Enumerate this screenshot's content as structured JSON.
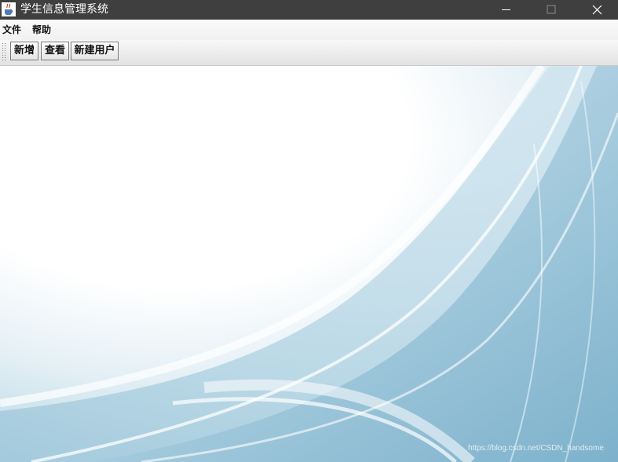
{
  "window": {
    "title": "学生信息管理系统",
    "app_icon": "java-cup-icon",
    "controls": [
      "minimize-icon",
      "maximize-icon",
      "close-icon"
    ]
  },
  "menubar": {
    "items": [
      {
        "label": "文件"
      },
      {
        "label": "帮助"
      }
    ]
  },
  "toolbar": {
    "buttons": [
      {
        "label": "新增"
      },
      {
        "label": "查看"
      },
      {
        "label": "新建用户"
      }
    ]
  },
  "watermark": "https://blog.csdn.net/CSDN_handsome",
  "colors": {
    "titlebar": "#3f3f3f",
    "background_accent": "#7fb5cf"
  }
}
